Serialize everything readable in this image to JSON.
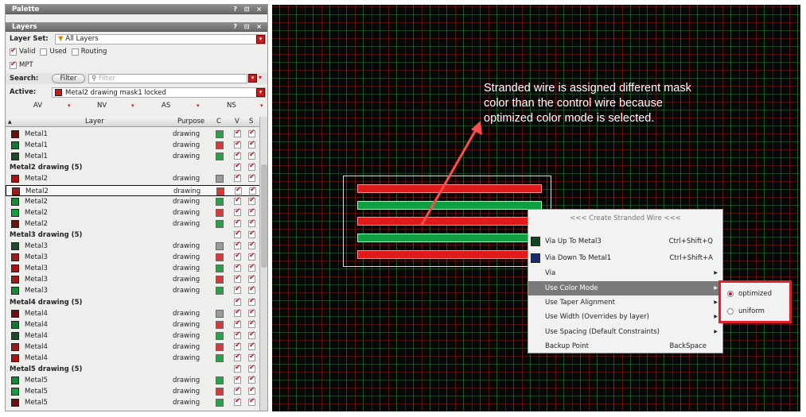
{
  "palette": {
    "title": "Palette",
    "controls": "? ⊡ ×"
  },
  "layers": {
    "title": "Layers",
    "controls": "? ⊡ ×",
    "layer_set_label": "Layer Set:",
    "layer_set_value": "All Layers",
    "filters": [
      {
        "label": "Valid",
        "checked": true
      },
      {
        "label": "Used",
        "checked": false
      },
      {
        "label": "Routing",
        "checked": false
      },
      {
        "label": "MPT",
        "checked": true
      }
    ],
    "search_label": "Search:",
    "filter_button": "Filter",
    "search_placeholder": "Filter",
    "active_label": "Active:",
    "active_value": "Metal2 drawing mask1 locked",
    "columns_top": [
      "AV",
      "NV",
      "AS",
      "NS"
    ],
    "columns": {
      "layer": "Layer",
      "purpose": "Purpose",
      "c": "C",
      "v": "V",
      "s": "S"
    },
    "rows": [
      {
        "group": false,
        "name": "Metal1",
        "purpose": "drawing"
      },
      {
        "group": false,
        "name": "Metal1",
        "purpose": "drawing"
      },
      {
        "group": false,
        "name": "Metal1",
        "purpose": "drawing"
      },
      {
        "group": true,
        "name": "Metal2 drawing (5)"
      },
      {
        "group": false,
        "name": "Metal2",
        "purpose": "drawing"
      },
      {
        "group": false,
        "name": "Metal2",
        "purpose": "drawing"
      },
      {
        "group": false,
        "name": "Metal2",
        "purpose": "drawing"
      },
      {
        "group": false,
        "name": "Metal2",
        "purpose": "drawing"
      },
      {
        "group": false,
        "name": "Metal2",
        "purpose": "drawing"
      },
      {
        "group": true,
        "name": "Metal3 drawing (5)"
      },
      {
        "group": false,
        "name": "Metal3",
        "purpose": "drawing"
      },
      {
        "group": false,
        "name": "Metal3",
        "purpose": "drawing"
      },
      {
        "group": false,
        "name": "Metal3",
        "purpose": "drawing"
      },
      {
        "group": false,
        "name": "Metal3",
        "purpose": "drawing"
      },
      {
        "group": false,
        "name": "Metal3",
        "purpose": "drawing"
      },
      {
        "group": true,
        "name": "Metal4 drawing (5)"
      },
      {
        "group": false,
        "name": "Metal4",
        "purpose": "drawing"
      },
      {
        "group": false,
        "name": "Metal4",
        "purpose": "drawing"
      },
      {
        "group": false,
        "name": "Metal4",
        "purpose": "drawing"
      },
      {
        "group": false,
        "name": "Metal4",
        "purpose": "drawing"
      },
      {
        "group": false,
        "name": "Metal4",
        "purpose": "drawing"
      },
      {
        "group": true,
        "name": "Metal5 drawing (5)"
      },
      {
        "group": false,
        "name": "Metal5",
        "purpose": "drawing"
      },
      {
        "group": false,
        "name": "Metal5",
        "purpose": "drawing"
      },
      {
        "group": false,
        "name": "Metal5",
        "purpose": "drawing"
      }
    ]
  },
  "annotation": "Stranded wire is assigned different mask color than the control wire because optimized color mode is selected.",
  "context_menu": {
    "header": "<<< Create Stranded Wire <<<",
    "items": [
      {
        "label": "Via Up To Metal3",
        "shortcut": "Ctrl+Shift+Q"
      },
      {
        "label": "Via Down To Metal1",
        "shortcut": "Ctrl+Shift+A"
      },
      {
        "label": "Via",
        "shortcut": ""
      },
      {
        "label": "Use Color Mode",
        "shortcut": ""
      },
      {
        "label": "Use Taper Alignment",
        "shortcut": ""
      },
      {
        "label": "Use Width (Overrides by layer)",
        "shortcut": ""
      },
      {
        "label": "Use Spacing (Default Constraints)",
        "shortcut": ""
      },
      {
        "label": "Backup Point",
        "shortcut": "BackSpace"
      }
    ]
  },
  "submenu": {
    "items": [
      {
        "label": "optimized",
        "selected": true
      },
      {
        "label": "uniform",
        "selected": false
      }
    ]
  },
  "colors": {
    "accent_red": "#c8102e",
    "wire_red": "#e01a1a",
    "wire_green": "#0f9e40"
  }
}
